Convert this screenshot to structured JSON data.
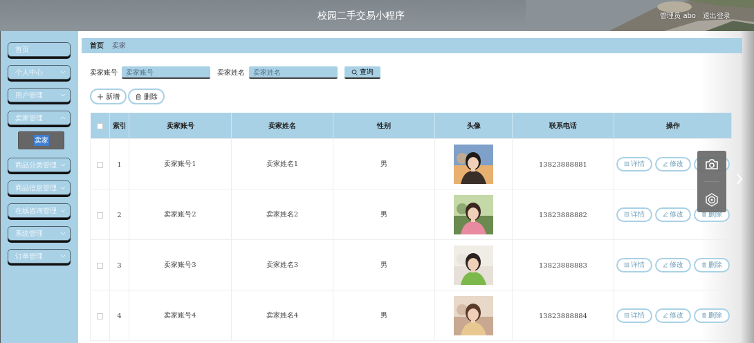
{
  "header": {
    "title": "校园二手交易小程序",
    "user": "管理员 abo",
    "logout": "退出登录",
    "background": {
      "kind": "picture"
    }
  },
  "sidebar": {
    "items": [
      {
        "label": "首页",
        "kind": "link"
      },
      {
        "label": "个人中心",
        "kind": "menu",
        "expanded": false
      },
      {
        "label": "用户管理",
        "kind": "menu",
        "expanded": false
      },
      {
        "label": "卖家管理",
        "kind": "menu",
        "expanded": true,
        "children": [
          {
            "label": "卖家",
            "selected": true
          }
        ]
      },
      {
        "label": "商品分类管理",
        "kind": "menu",
        "expanded": false
      },
      {
        "label": "商品信息管理",
        "kind": "menu",
        "expanded": false
      },
      {
        "label": "在线咨询管理",
        "kind": "menu",
        "expanded": false
      },
      {
        "label": "系统管理",
        "kind": "menu",
        "expanded": false
      },
      {
        "label": "订单管理",
        "kind": "menu",
        "expanded": false
      }
    ]
  },
  "breadcrumb": [
    {
      "label": "首页",
      "current": false
    },
    {
      "label": "卖家",
      "current": true
    }
  ],
  "search": {
    "fields": [
      {
        "label": "卖家账号",
        "placeholder": "卖家账号"
      },
      {
        "label": "卖家姓名",
        "placeholder": "卖家姓名"
      }
    ],
    "button": "查询"
  },
  "toolbar": [
    {
      "label": "新增",
      "kind": "add"
    },
    {
      "label": "删除",
      "kind": "delete"
    }
  ],
  "table": {
    "header_checked": false,
    "columns": [
      "索引",
      "卖家账号",
      "卖家姓名",
      "性别",
      "头像",
      "联系电话",
      "操作"
    ],
    "rows": [
      {
        "checked": false,
        "index": "1",
        "account": "卖家账号1",
        "name": "卖家姓名1",
        "gender": "男",
        "avatar": {
          "kind": "picture"
        },
        "phone": "13823888881",
        "actions": [
          {
            "kind": "detail",
            "label": "详情"
          },
          {
            "kind": "edit",
            "label": "修改"
          },
          {
            "kind": "delete"
          }
        ]
      },
      {
        "checked": false,
        "index": "2",
        "account": "卖家账号2",
        "name": "卖家姓名2",
        "gender": "男",
        "avatar": {
          "kind": "picture"
        },
        "phone": "13823888882",
        "actions": [
          {
            "kind": "detail",
            "label": "详情"
          },
          {
            "kind": "edit",
            "label": "修改"
          },
          {
            "kind": "delete",
            "label": "删除"
          }
        ]
      },
      {
        "checked": false,
        "index": "3",
        "account": "卖家账号3",
        "name": "卖家姓名3",
        "gender": "男",
        "avatar": {
          "kind": "picture"
        },
        "phone": "13823888883",
        "actions": [
          {
            "kind": "detail",
            "label": "详情"
          },
          {
            "kind": "edit",
            "label": "修改"
          },
          {
            "kind": "delete",
            "label": "删除"
          }
        ]
      },
      {
        "checked": false,
        "index": "4",
        "account": "卖家账号4",
        "name": "卖家姓名4",
        "gender": "男",
        "avatar": {
          "kind": "picture"
        },
        "phone": "13823888884",
        "actions": [
          {
            "kind": "detail",
            "label": "详情"
          },
          {
            "kind": "edit",
            "label": "修改"
          },
          {
            "kind": "delete",
            "label": "删除"
          }
        ]
      }
    ]
  },
  "player_tools": {
    "buttons": [
      {
        "kind": "camera"
      },
      {
        "kind": "target"
      }
    ],
    "next_arrow": true
  }
}
